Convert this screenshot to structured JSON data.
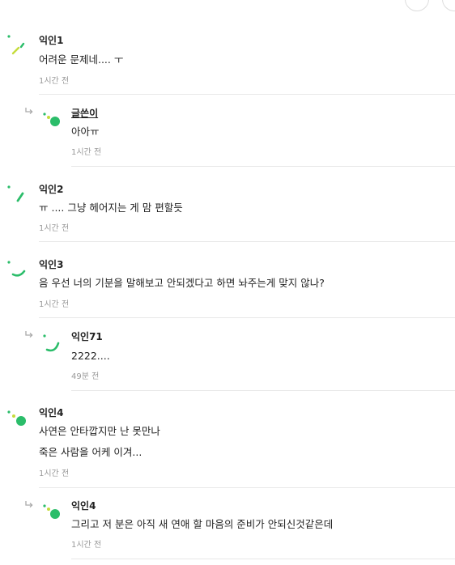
{
  "comments": [
    {
      "author": "익인1",
      "lines": [
        "어려운 문제네.... ㅜ"
      ],
      "time": "1시간 전",
      "avatar_icon": "green-slash-avatar-icon"
    },
    {
      "author": "글쓴이",
      "lines": [
        "아아ㅠ"
      ],
      "time": "1시간 전",
      "is_reply": true,
      "is_writer": true,
      "avatar_icon": "green-dot-avatar-icon"
    },
    {
      "author": "익인2",
      "lines": [
        "ㅠ .... 그냥 헤어지는 게 맘 편할듯"
      ],
      "time": "1시간 전",
      "avatar_icon": "green-slash-avatar-icon"
    },
    {
      "author": "익인3",
      "lines": [
        "음 우선 너의 기분을 말해보고 안되겠다고 하면 놔주는게 맞지 않나?"
      ],
      "time": "1시간 전",
      "avatar_icon": "green-arc-avatar-icon"
    },
    {
      "author": "익인71",
      "lines": [
        "2222...."
      ],
      "time": "49분 전",
      "is_reply": true,
      "avatar_icon": "green-arc-avatar-icon"
    },
    {
      "author": "익인4",
      "lines": [
        "사연은 안타깝지만 난 못만나",
        "죽은 사람을 어케 이겨..."
      ],
      "time": "1시간 전",
      "avatar_icon": "green-dot-avatar-icon"
    },
    {
      "author": "익인4",
      "lines": [
        "그리고 저 분은 아직 새 연애 할 마음의 준비가 안되신것같은데"
      ],
      "time": "1시간 전",
      "is_reply": true,
      "avatar_icon": "green-dot-avatar-icon"
    }
  ],
  "colors": {
    "accent_green": "#2bbd6a",
    "accent_lime": "#c5dc3c",
    "text": "#222222",
    "muted": "#999999",
    "divider": "#e8e8e8"
  }
}
